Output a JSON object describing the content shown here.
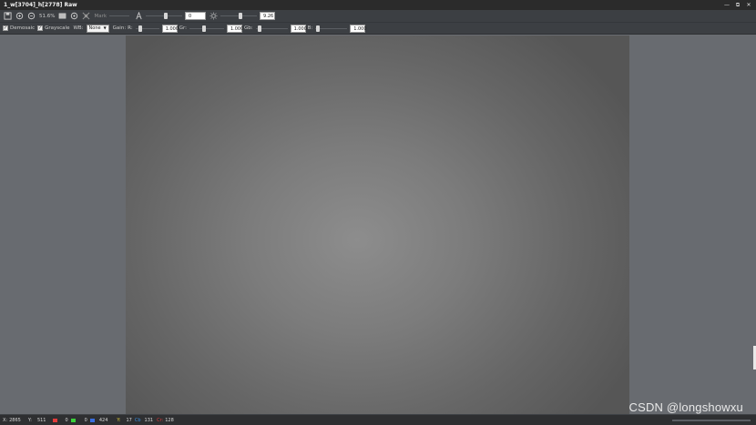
{
  "window": {
    "title": "1_w[3704]_h[2778] Raw",
    "controls": [
      "—",
      "⧉",
      "✕"
    ]
  },
  "toolbar1": {
    "zoom": "51.6%",
    "mark_label": "Mark",
    "offset_value": "0",
    "gamma_value": "9.26",
    "icons": [
      "save-icon",
      "zoom-in-icon",
      "zoom-out-icon",
      "fit-icon",
      "rotate-icon",
      "mark-icon",
      "gamma-icon",
      "brightness-icon"
    ]
  },
  "toolbar2": {
    "demosaic_label": "Demosaic",
    "demosaic_checked": true,
    "grayscale_label": "Grayscale",
    "grayscale_checked": true,
    "wb_label": "WB:",
    "wb_value": "None",
    "gain_label": "Gain:",
    "r_label": "R:",
    "r_value": "1.000",
    "gr_label": "Gr:",
    "gr_value": "1.000",
    "gb_label": "Gb:",
    "gb_value": "1.000",
    "b_label": "B:",
    "b_value": "1.000"
  },
  "statusbar": {
    "x_label": "X:",
    "x_value": "2865",
    "y_label": "Y:",
    "y_value": "511",
    "r_value": "0",
    "g_value": "0",
    "b_value": "424",
    "y2_label": "Y:",
    "y2_value": "17",
    "cb_label": "Cb",
    "cb_value": "131",
    "cr_label": "Cr:",
    "cr_value": "128",
    "r_color": "#e23b3b",
    "g_color": "#3ad13a",
    "b_color": "#3a6fe0"
  },
  "watermark": "CSDN @longshowxu",
  "colors": {
    "titlebar": "#2b2b2b",
    "toolbar": "#3c3f43",
    "viewport": "#686b70",
    "image_center": "#8d8d8d",
    "image_edge": "#565656"
  }
}
